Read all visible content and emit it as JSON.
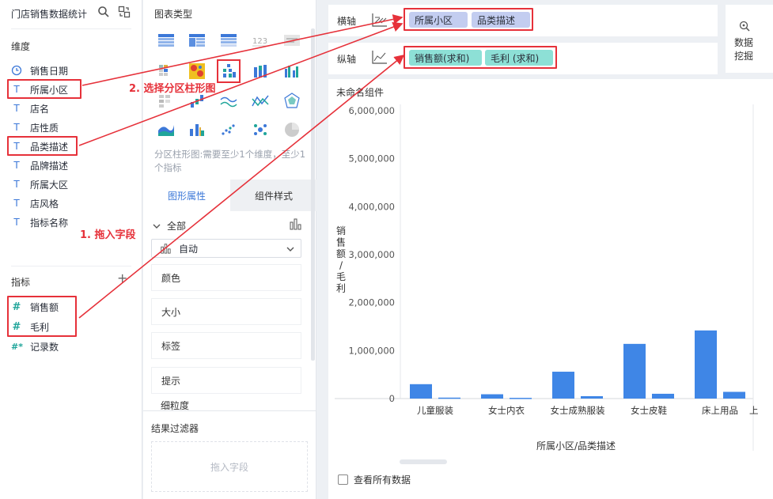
{
  "left": {
    "title": "门店销售数据统计",
    "dimension_title": "维度",
    "dimensions": [
      {
        "label": "销售日期",
        "type": "date-icon"
      },
      {
        "label": "所属小区",
        "type": "T"
      },
      {
        "label": "店名",
        "type": "T"
      },
      {
        "label": "店性质",
        "type": "T"
      },
      {
        "label": "品类描述",
        "type": "T"
      },
      {
        "label": "品牌描述",
        "type": "T"
      },
      {
        "label": "所属大区",
        "type": "T"
      },
      {
        "label": "店风格",
        "type": "T"
      },
      {
        "label": "指标名称",
        "type": "T"
      }
    ],
    "measure_title": "指标",
    "measures": [
      {
        "label": "销售额",
        "type": "#"
      },
      {
        "label": "毛利",
        "type": "#"
      },
      {
        "label": "记录数",
        "type": "#*"
      }
    ]
  },
  "middle": {
    "chart_type_title": "图表类型",
    "hint": "分区柱形图:需要至少1个维度，至少1个指标",
    "tabs": [
      "图形属性",
      "组件样式"
    ],
    "all_label": "全部",
    "auto_label": "自动",
    "props": [
      "颜色",
      "大小",
      "标签",
      "提示",
      "细粒度"
    ],
    "filter_title": "结果过滤器",
    "filter_placeholder": "拖入字段"
  },
  "axes": {
    "x_label": "横轴",
    "y_label": "纵轴",
    "x_fields": [
      "所属小区",
      "品类描述"
    ],
    "y_fields": [
      "销售额(求和)",
      "毛利  (求和)"
    ],
    "data_mining": [
      "数据",
      "挖掘"
    ]
  },
  "annotations": {
    "step1": "1. 拖入字段",
    "step2": "2. 选择分区柱形图"
  },
  "chart": {
    "component_title": "未命名组件",
    "show_all_label": "查看所有数据"
  },
  "colors": {
    "bar": "#3f86e6",
    "x_pill": "#c3cdf0",
    "y_pill": "#8de0d6",
    "annotation": "#e6313a"
  },
  "chart_data": {
    "type": "bar",
    "categories": [
      "儿童服装",
      "女士内衣",
      "女士成熟服装",
      "女士皮鞋",
      "床上用品",
      "上"
    ],
    "series": [
      {
        "name": "销售额",
        "values": [
          300000,
          90000,
          560000,
          1140000,
          1420000,
          0
        ]
      },
      {
        "name": "毛利",
        "values": [
          20000,
          15000,
          50000,
          100000,
          140000,
          0
        ]
      }
    ],
    "y_ticks": [
      "6,000,000",
      "5,000,000",
      "4,000,000",
      "3,000,000",
      "2,000,000",
      "1,000,000",
      "0"
    ],
    "xlabel": "所属小区/品类描述",
    "ylabel": "销售额/毛利",
    "ylim": [
      0,
      6000000
    ]
  }
}
